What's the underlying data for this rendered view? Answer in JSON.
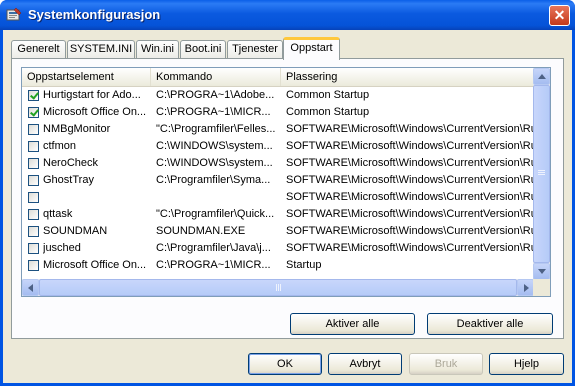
{
  "window": {
    "title": "Systemkonfigurasjon",
    "close_label": "✕"
  },
  "tabs": [
    {
      "label": "Generelt",
      "active": false
    },
    {
      "label": "SYSTEM.INI",
      "active": false
    },
    {
      "label": "Win.ini",
      "active": false
    },
    {
      "label": "Boot.ini",
      "active": false
    },
    {
      "label": "Tjenester",
      "active": false
    },
    {
      "label": "Oppstart",
      "active": true
    }
  ],
  "list": {
    "columns": [
      "Oppstartselement",
      "Kommando",
      "Plassering"
    ],
    "rows": [
      {
        "checked": true,
        "name": "Hurtigstart for Ado...",
        "command": "C:\\PROGRA~1\\Adobe...",
        "location": "Common Startup"
      },
      {
        "checked": true,
        "name": "Microsoft Office On...",
        "command": "C:\\PROGRA~1\\MICR...",
        "location": "Common Startup"
      },
      {
        "checked": false,
        "name": "NMBgMonitor",
        "command": "\"C:\\Programfiler\\Felles...",
        "location": "SOFTWARE\\Microsoft\\Windows\\CurrentVersion\\Ru"
      },
      {
        "checked": false,
        "name": "ctfmon",
        "command": "C:\\WINDOWS\\system...",
        "location": "SOFTWARE\\Microsoft\\Windows\\CurrentVersion\\Ru"
      },
      {
        "checked": false,
        "name": "NeroCheck",
        "command": "C:\\WINDOWS\\system...",
        "location": "SOFTWARE\\Microsoft\\Windows\\CurrentVersion\\Ru"
      },
      {
        "checked": false,
        "name": "GhostTray",
        "command": "C:\\Programfiler\\Syma...",
        "location": "SOFTWARE\\Microsoft\\Windows\\CurrentVersion\\Ru"
      },
      {
        "checked": false,
        "name": "",
        "command": "",
        "location": "SOFTWARE\\Microsoft\\Windows\\CurrentVersion\\Ru"
      },
      {
        "checked": false,
        "name": "qttask",
        "command": "\"C:\\Programfiler\\Quick...",
        "location": "SOFTWARE\\Microsoft\\Windows\\CurrentVersion\\Ru"
      },
      {
        "checked": false,
        "name": "SOUNDMAN",
        "command": "SOUNDMAN.EXE",
        "location": "SOFTWARE\\Microsoft\\Windows\\CurrentVersion\\Ru"
      },
      {
        "checked": false,
        "name": "jusched",
        "command": "C:\\Programfiler\\Java\\j...",
        "location": "SOFTWARE\\Microsoft\\Windows\\CurrentVersion\\Ru"
      },
      {
        "checked": false,
        "name": "Microsoft Office On...",
        "command": "C:\\PROGRA~1\\MICR...",
        "location": "Startup"
      }
    ]
  },
  "panel_buttons": {
    "enable_all": "Aktiver alle",
    "disable_all": "Deaktiver alle"
  },
  "dialog_buttons": {
    "ok": "OK",
    "cancel": "Avbryt",
    "apply": "Bruk",
    "help": "Hjelp"
  },
  "colors": {
    "titlebar": "#0054e3",
    "face": "#ece9d8",
    "active_tab_accent": "#ffc83c",
    "check": "#21a121"
  },
  "icons": {
    "app": "msconfig-icon",
    "close": "close-icon"
  }
}
